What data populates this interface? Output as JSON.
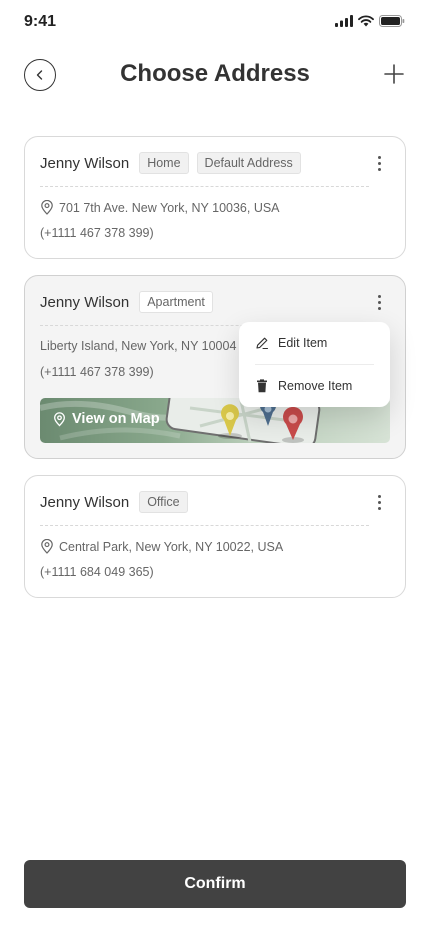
{
  "status_bar": {
    "time": "9:41"
  },
  "header": {
    "title": "Choose Address"
  },
  "addresses": [
    {
      "name": "Jenny Wilson",
      "tags": [
        "Home",
        "Default Address"
      ],
      "address": "701 7th Ave. New York, NY 10036, USA",
      "phone": "(+1111 467 378 399)"
    },
    {
      "name": "Jenny Wilson",
      "tags": [
        "Apartment"
      ],
      "address": "Liberty Island, New York, NY 10004",
      "phone": "(+1111 467 378 399)",
      "map_button": "View on Map"
    },
    {
      "name": "Jenny Wilson",
      "tags": [
        "Office"
      ],
      "address": "Central Park, New York, NY 10022, USA",
      "phone": "(+1111 684 049 365)"
    }
  ],
  "context_menu": {
    "edit": "Edit Item",
    "remove": "Remove Item"
  },
  "confirm_label": "Confirm",
  "icons": [
    "back-arrow-icon",
    "plus-icon",
    "more-vertical-icon",
    "location-pin-icon",
    "pencil-icon",
    "trash-icon",
    "signal-icon",
    "wifi-icon",
    "battery-icon"
  ]
}
